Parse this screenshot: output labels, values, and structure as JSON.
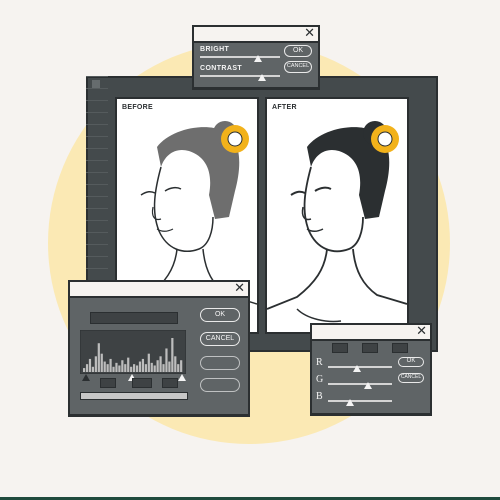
{
  "before_label": "BEFORE",
  "after_label": "AFTER",
  "adjust_dialog": {
    "bright_label": "BRIGHT",
    "contrast_label": "CONTRAST",
    "ok_label": "OK",
    "cancel_label": "CANCEL",
    "close_icon": "close-icon",
    "bright_value": 0.72,
    "contrast_value": 0.78
  },
  "levels_dialog": {
    "ok_label": "OK",
    "cancel_label": "CANCEL",
    "close_icon": "close-icon",
    "histogram": [
      3,
      6,
      10,
      4,
      12,
      22,
      14,
      8,
      6,
      10,
      4,
      7,
      5,
      9,
      6,
      11,
      4,
      6,
      5,
      8,
      10,
      6,
      14,
      7,
      5,
      9,
      12,
      6,
      18,
      8,
      26,
      12,
      6,
      9
    ]
  },
  "rgb_dialog": {
    "r_label": "R",
    "g_label": "G",
    "b_label": "B",
    "ok_label": "OK",
    "cancel_label": "CANCEL",
    "close_icon": "close-icon",
    "r_value": 0.45,
    "g_value": 0.62,
    "b_value": 0.35
  },
  "colors": {
    "accent": "#f2b21b",
    "background_circle": "#fbe9b4",
    "dark": "#2b2f31",
    "panel_gray": "#5f6466"
  }
}
